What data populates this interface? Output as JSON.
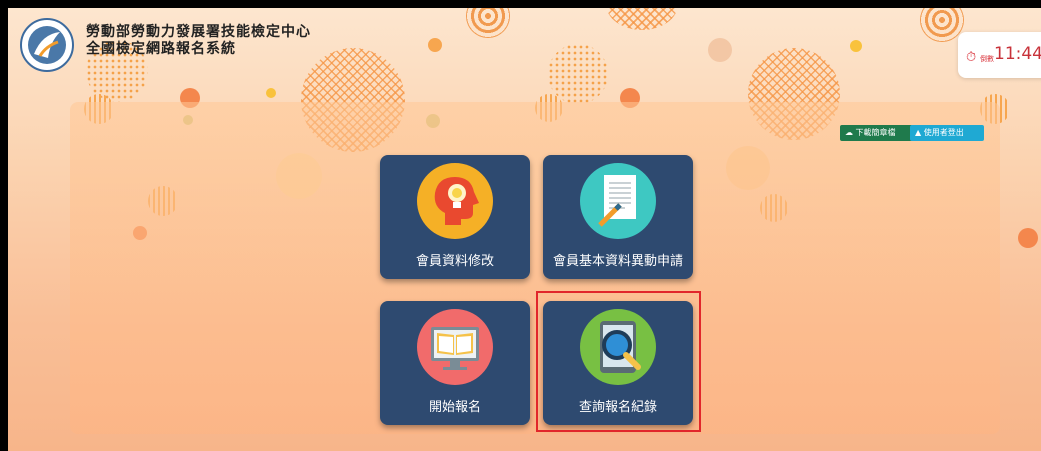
{
  "header": {
    "title_line1": "勞動部勞動力發展署技能檢定中心",
    "title_line2": "全國檢定網路報名系統"
  },
  "logo": {
    "icon": "agency-logo-icon"
  },
  "session": {
    "icon": "timer-icon",
    "label": "倒數",
    "time": "11:44"
  },
  "toolbar": {
    "download_label": "下載簡章檔",
    "logout_label": "使用者登出"
  },
  "menu": {
    "tiles": [
      {
        "label": "會員資料修改",
        "icon": "head-lightbulb-icon",
        "color": "#f5b026"
      },
      {
        "label": "會員基本資料異動申請",
        "icon": "document-pencil-icon",
        "color": "#3ec8c2"
      },
      {
        "label": "開始報名",
        "icon": "monitor-book-icon",
        "color": "#f16b6b"
      },
      {
        "label": "查詢報名紀錄",
        "icon": "tablet-magnifier-icon",
        "color": "#78c043"
      }
    ]
  },
  "colors": {
    "tile_bg": "#2e4a70",
    "highlight": "#e1262b",
    "download_btn": "#1f7a4c",
    "logout_btn": "#1fa9d3"
  }
}
